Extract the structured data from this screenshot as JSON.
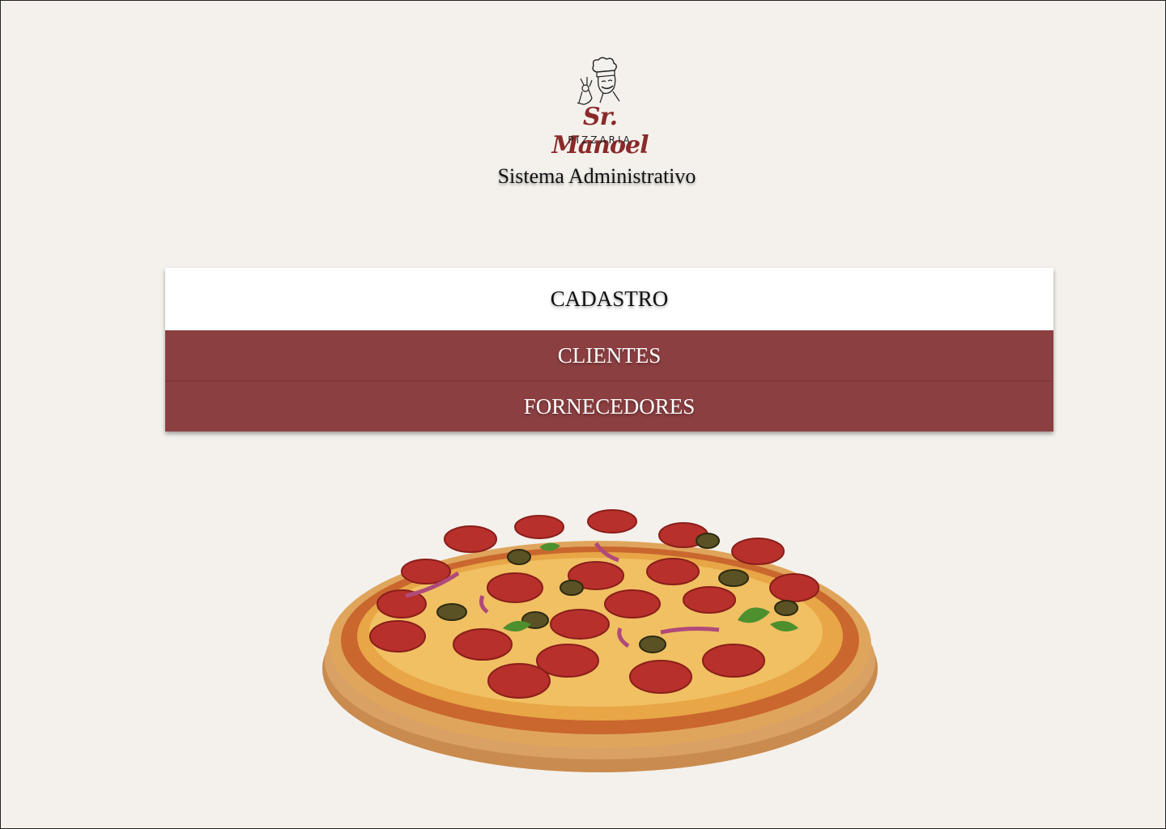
{
  "brand": {
    "name": "Sr. Manoel",
    "subtitle": "PIZZARIA"
  },
  "system_title": "Sistema Administrativo",
  "menu": {
    "header": "CADASTRO",
    "items": [
      {
        "label": "CLIENTES"
      },
      {
        "label": "FORNECEDORES"
      }
    ]
  },
  "colors": {
    "background": "#f4f1ec",
    "menu_item": "#8c3f41",
    "brand": "#8a2a2a"
  },
  "images": {
    "logo": "chef-logo",
    "hero": "pepperoni-pizza-image"
  }
}
